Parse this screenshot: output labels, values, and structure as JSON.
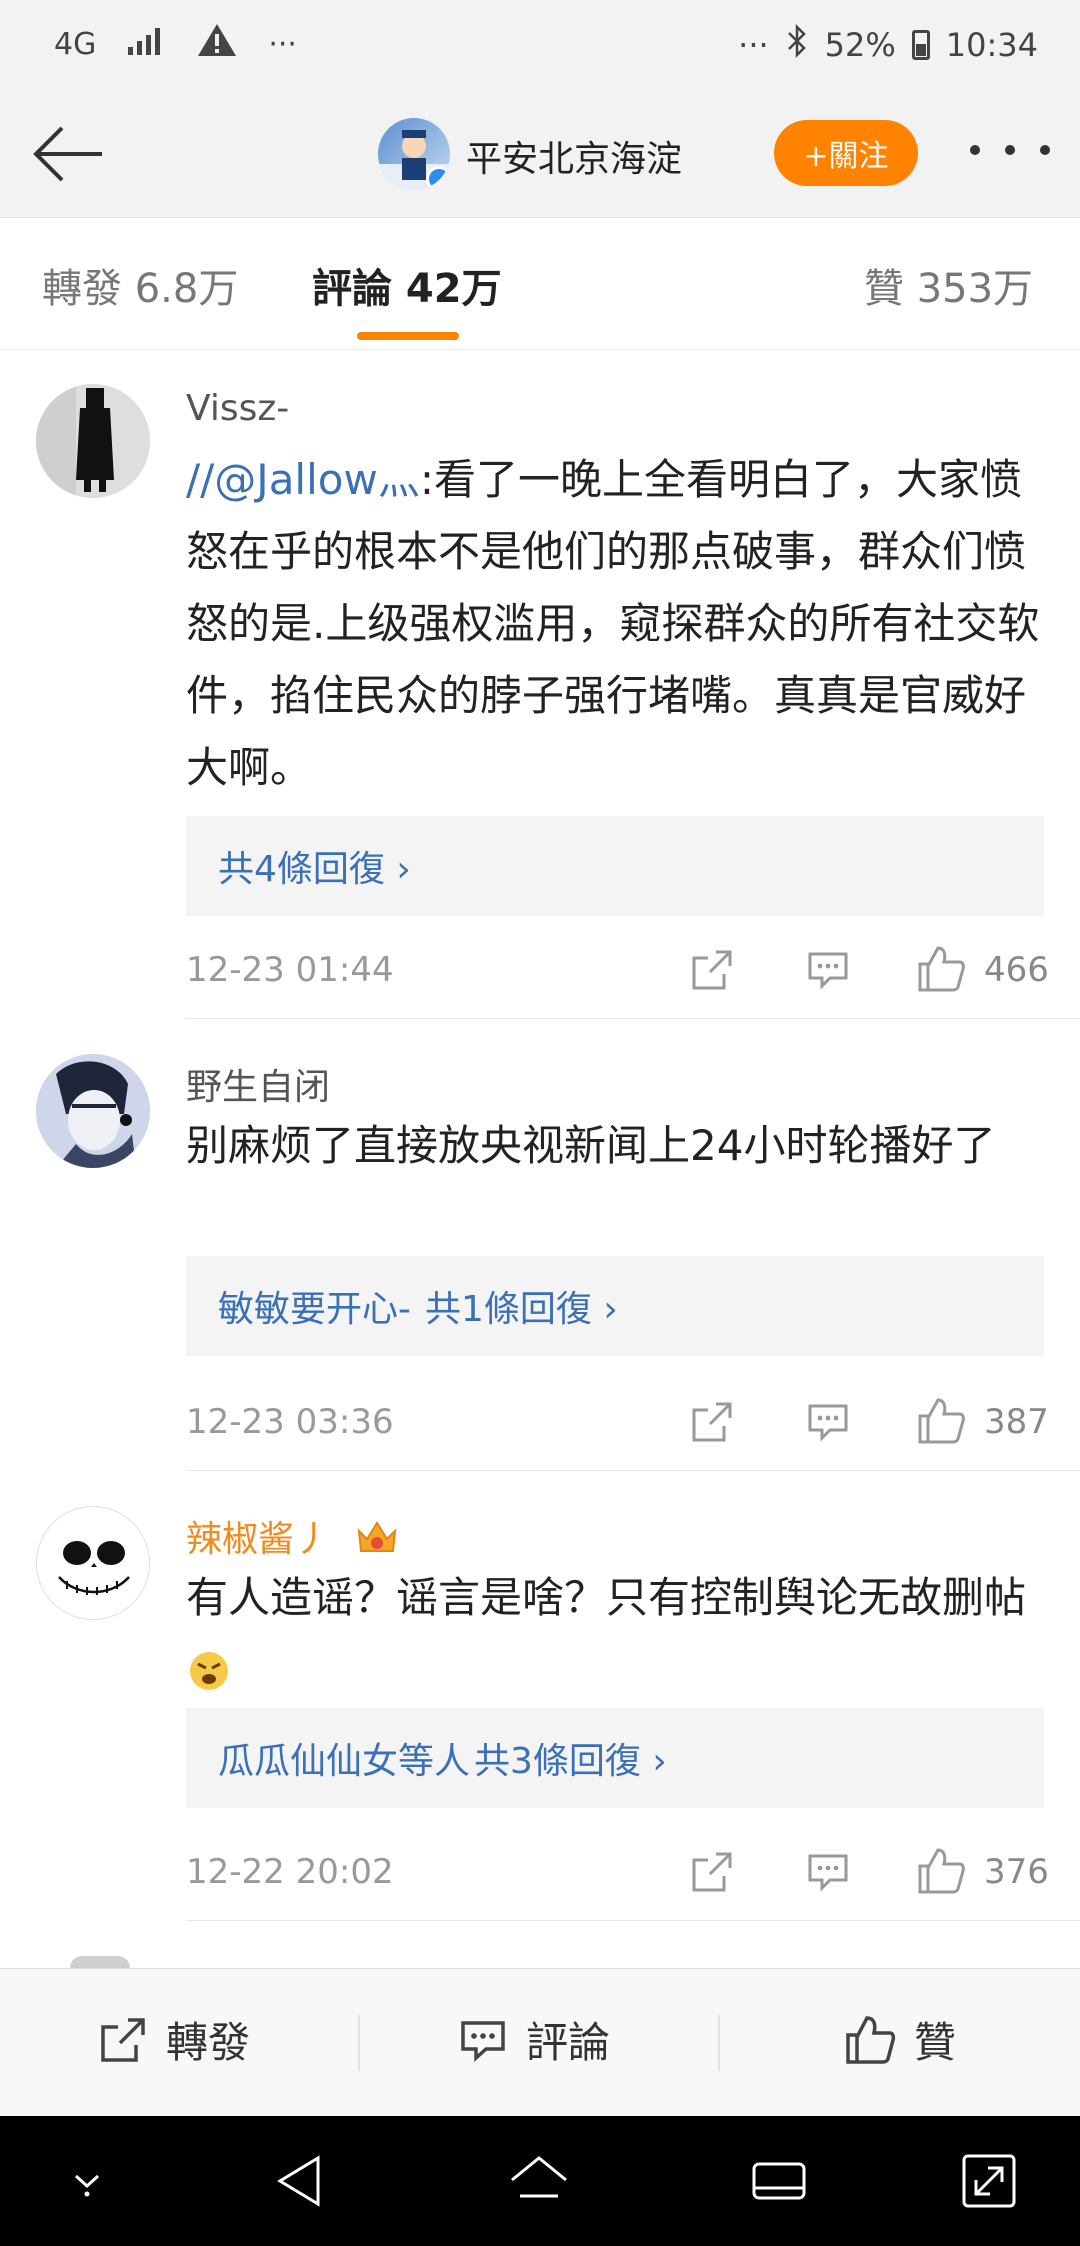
{
  "status_bar": {
    "network": "4G",
    "battery_percent": "52%",
    "time": "10:34",
    "more_left": "···",
    "more_right": "···"
  },
  "header": {
    "account_name": "平安北京海淀",
    "follow_label": "+關注"
  },
  "tabs": [
    {
      "label": "轉發 6.8万"
    },
    {
      "label": "評論 42万"
    },
    {
      "label": "贊 353万"
    }
  ],
  "comments": [
    {
      "user": "Vissz-",
      "mention": "//@Jallow灬",
      "text": ":看了一晚上全看明白了，大家愤怒在乎的根本不是他们的那点破事，群众们愤怒的是.上级强权滥用，窥探群众的所有社交软件，掐住民众的脖子强行堵嘴。真真是官威好大啊。",
      "replies": "共4條回復 ›",
      "time": "12-23 01:44",
      "likes": "466"
    },
    {
      "user": "野生自闭",
      "text": "别麻烦了直接放央视新闻上24小时轮播好了",
      "replies_prefix": "敏敏要开心-",
      "replies": "共1條回復 ›",
      "time": "12-23 03:36",
      "likes": "387"
    },
    {
      "user": "辣椒酱丿",
      "text": "有人造谣？谣言是啥？只有控制舆论无故删帖",
      "replies_prefix": "瓜瓜仙仙女等人",
      "replies": "共3條回復 ›",
      "time": "12-22 20:02",
      "likes": "376"
    }
  ],
  "bottom_bar": {
    "repost": "轉發",
    "comment": "評論",
    "like": "贊"
  }
}
